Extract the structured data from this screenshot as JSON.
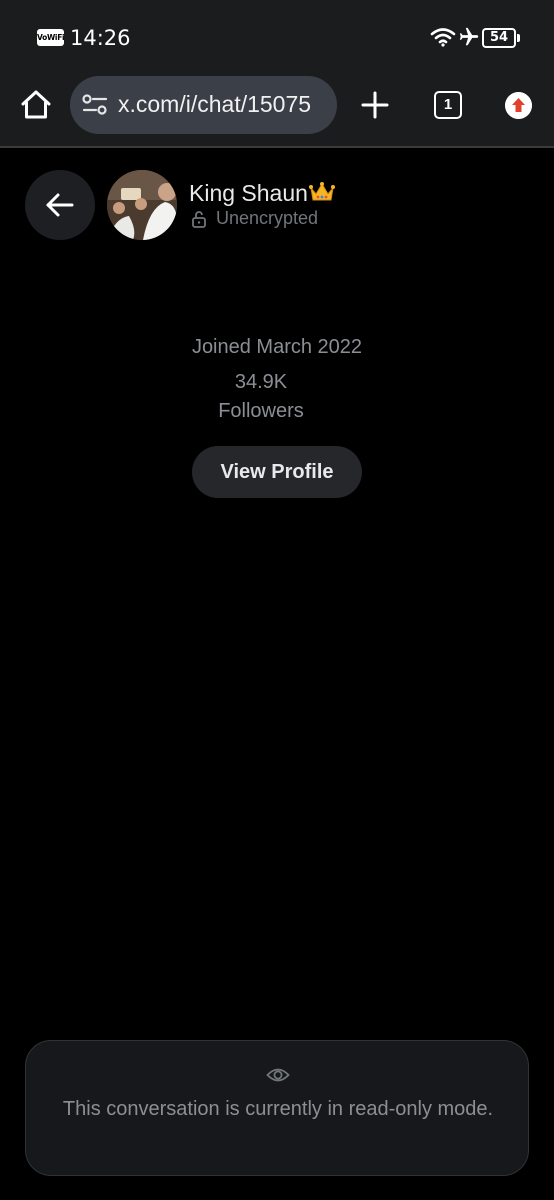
{
  "status_bar": {
    "vowifi": "VoWiFi",
    "time": "14:26",
    "battery": "54",
    "icons": [
      "wifi-icon",
      "airplane-icon",
      "battery-icon"
    ]
  },
  "browser": {
    "url": "x.com/i/chat/15075",
    "tab_count": "1",
    "icons": [
      "home-icon",
      "tune-icon",
      "plus-icon",
      "tabs-icon",
      "update-icon"
    ]
  },
  "chat_header": {
    "name": "King Shaun",
    "name_emoji": "crown-icon",
    "encryption_status": "Unencrypted",
    "icons": [
      "back-arrow-icon",
      "lock-icon"
    ]
  },
  "profile": {
    "joined": "Joined March 2022",
    "followers_count": "34.9K",
    "followers_label": "Followers",
    "view_profile_label": "View Profile"
  },
  "notice": {
    "text": "This conversation is currently in read-only mode.",
    "icon": "eye-icon"
  },
  "colors": {
    "background": "#000000",
    "bar_background": "#1b1c1e",
    "url_box": "#3b4048",
    "secondary_text": "#71767b",
    "button_background": "#25272a",
    "update_accent": "#e0402c"
  }
}
